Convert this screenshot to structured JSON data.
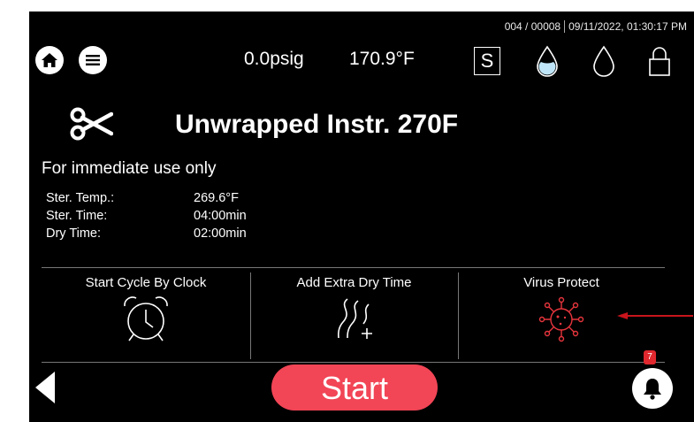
{
  "status_bar": {
    "cycle_count": "004 / 00008",
    "datetime": "09/11/2022, 01:30:17 PM"
  },
  "header": {
    "pressure": "0.0psig",
    "temperature": "170.9°F",
    "s_indicator": "S",
    "icons": [
      "home-icon",
      "menu-icon",
      "water-drop-filled-icon",
      "water-drop-outline-icon",
      "lock-icon"
    ]
  },
  "cycle": {
    "title": "Unwrapped Instr. 270F",
    "subtitle": "For immediate use only",
    "params": [
      {
        "label": "Ster. Temp.:",
        "value": "269.6°F"
      },
      {
        "label": "Ster. Time:",
        "value": "04:00min"
      },
      {
        "label": "Dry Time:",
        "value": "02:00min"
      }
    ]
  },
  "options": [
    {
      "label": "Start Cycle By Clock",
      "icon": "alarm-clock-icon"
    },
    {
      "label": "Add Extra Dry Time",
      "icon": "add-dry-time-icon"
    },
    {
      "label": "Virus Protect",
      "icon": "virus-icon"
    }
  ],
  "footer": {
    "start_label": "Start",
    "notification_count": "7"
  },
  "colors": {
    "start_button": "#f24556",
    "virus_icon": "#e8353d",
    "badge": "#e0282e",
    "annotation_arrow": "#c8141c"
  }
}
